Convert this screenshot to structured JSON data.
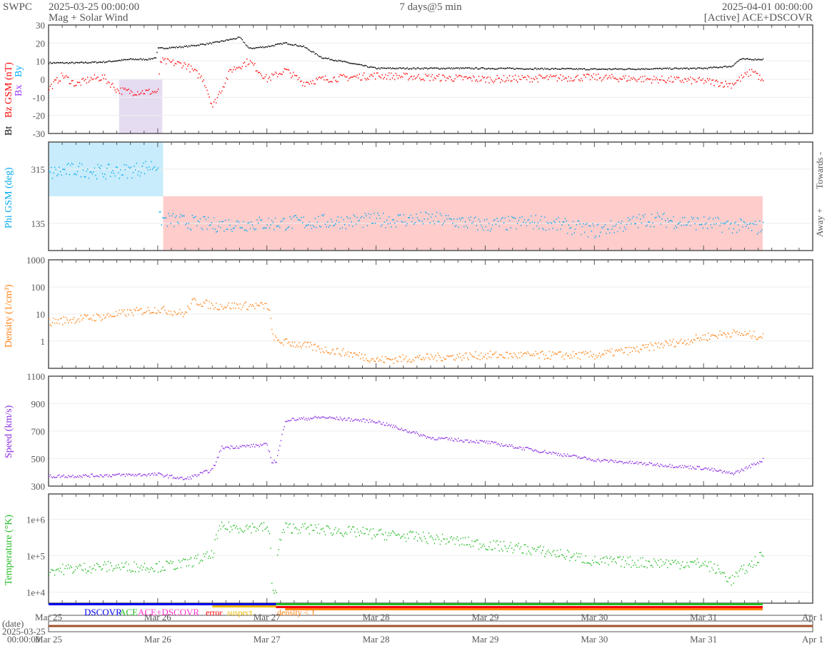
{
  "header": {
    "org": "SWPC",
    "start": "2025-03-25 00:00:00",
    "subtitle": "Mag + Solar Wind",
    "span": "7 days@5 min",
    "end": "2025-04-01 00:00:00",
    "source": "[Active] ACE+DSCOVR"
  },
  "legend": {
    "dscovr": "DSCOVR",
    "ace": "ACE",
    "both": "ACE+DSCOVR",
    "error": "error",
    "suspect": "suspect",
    "density": "density < 1"
  },
  "date_axis": {
    "label": "(date)",
    "ref_date": "2025-03-25",
    "ref_time": "00:00:00",
    "ticks": [
      "Mar 25",
      "Mar 26",
      "Mar 27",
      "Mar 28",
      "Mar 29",
      "Mar 30",
      "Mar 31",
      "Apr 1"
    ]
  },
  "colors": {
    "bt": "#000000",
    "bz": "#ff0000",
    "by": "#00aaff",
    "bx": "#9933ff",
    "phi": "#00aaee",
    "density": "#ff7f0e",
    "speed": "#8a2be2",
    "temp": "#22bb22",
    "toward": "#c8ecfb",
    "away": "#ffcccc"
  },
  "chart_data": [
    {
      "type": "scatter",
      "ylabel_bt": "Bt",
      "ylabel_bz": "Bz GSM (nT)",
      "ylabel_bx": "Bx",
      "ylabel_by": "By",
      "ylim": [
        -30,
        30
      ],
      "yticks": [
        "30",
        "20",
        "10",
        "0",
        "-10",
        "-20",
        "-30"
      ],
      "xlim_hours": [
        0,
        168
      ],
      "series": [
        {
          "name": "Bt",
          "t": [
            0,
            6,
            12,
            18,
            22,
            23.5,
            24,
            30,
            36,
            40,
            42,
            44,
            48,
            52,
            56,
            60,
            66,
            72,
            96,
            120,
            144,
            149,
            150,
            152,
            157
          ],
          "v": [
            9,
            9,
            9.5,
            11,
            11,
            12,
            17,
            18,
            20,
            22,
            23,
            17,
            18,
            20,
            18,
            12,
            9,
            6,
            6,
            5.5,
            6,
            7,
            7,
            11,
            11
          ]
        },
        {
          "name": "Bz",
          "t": [
            0,
            3,
            6,
            9,
            12,
            15,
            18,
            24,
            24.5,
            30,
            34,
            36,
            38,
            40,
            44,
            48,
            52,
            56,
            60,
            72,
            96,
            120,
            144,
            150,
            155,
            157
          ],
          "v": [
            -5,
            2,
            -3,
            0,
            1,
            -6,
            -7,
            -7,
            10,
            8,
            0,
            -15,
            -5,
            5,
            10,
            0,
            5,
            -2,
            0,
            2,
            0,
            1,
            -1,
            -3,
            5,
            -2
          ]
        }
      ]
    },
    {
      "type": "scatter",
      "ylabel": "Phi GSM (deg)",
      "ylim": [
        45,
        405
      ],
      "yticks": [
        "315",
        "135"
      ],
      "right_labels": {
        "towards": "Towards -",
        "away": "Away +"
      },
      "series": [
        {
          "name": "Phi",
          "t": [
            0,
            6,
            12,
            18,
            24,
            24.2,
            30,
            36,
            48,
            60,
            72,
            84,
            96,
            108,
            120,
            132,
            144,
            156,
            157
          ],
          "v": [
            300,
            315,
            305,
            310,
            330,
            150,
            140,
            130,
            135,
            140,
            145,
            150,
            130,
            140,
            110,
            150,
            135,
            120,
            130
          ]
        }
      ]
    },
    {
      "type": "scatter",
      "ylabel": "Density (1/cm³)",
      "yscale": "log",
      "ylim": [
        0.1,
        1000
      ],
      "yticks": [
        "1000",
        "100",
        "10",
        "1"
      ],
      "series": [
        {
          "name": "Density",
          "t": [
            0,
            12,
            24,
            30,
            32,
            36,
            48,
            49,
            50,
            60,
            72,
            96,
            120,
            130,
            140,
            145,
            150,
            157
          ],
          "v": [
            5,
            8,
            15,
            10,
            30,
            20,
            20,
            2,
            1,
            0.5,
            0.2,
            0.3,
            0.3,
            0.5,
            1,
            1.5,
            2,
            1.5
          ]
        }
      ]
    },
    {
      "type": "scatter",
      "ylabel": "Speed (km/s)",
      "ylim": [
        300,
        1100
      ],
      "yticks": [
        "1100",
        "900",
        "700",
        "500",
        "300"
      ],
      "series": [
        {
          "name": "Speed",
          "t": [
            0,
            24,
            30,
            36,
            38,
            48,
            49,
            50,
            52,
            60,
            72,
            84,
            96,
            120,
            144,
            150,
            152,
            157
          ],
          "v": [
            370,
            385,
            350,
            420,
            580,
            600,
            480,
            480,
            780,
            800,
            770,
            650,
            620,
            490,
            430,
            390,
            410,
            490
          ]
        }
      ]
    },
    {
      "type": "scatter",
      "ylabel": "Temperature (°K)",
      "yscale": "log",
      "ylim": [
        5000,
        5000000
      ],
      "yticks": [
        "1e+6",
        "1e+5",
        "1e+4"
      ],
      "series": [
        {
          "name": "Temperature",
          "t": [
            0,
            12,
            24,
            30,
            36,
            38,
            48,
            49,
            50,
            52,
            72,
            96,
            120,
            144,
            150,
            154,
            157
          ],
          "v": [
            40000,
            50000,
            50000,
            60000,
            100000,
            600000,
            600000,
            15000,
            10000,
            600000,
            400000,
            200000,
            70000,
            60000,
            20000,
            50000,
            100000
          ]
        }
      ]
    }
  ]
}
